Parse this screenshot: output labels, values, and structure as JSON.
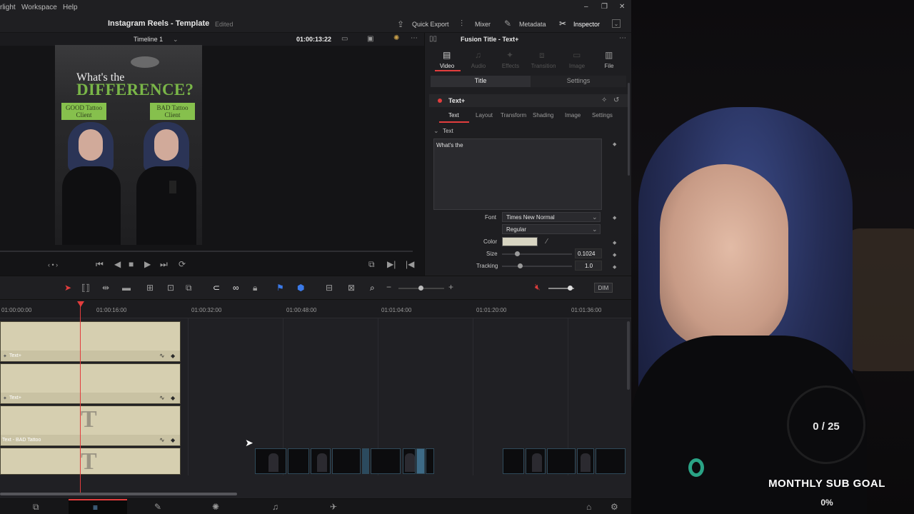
{
  "menu": {
    "app_fragment": "rlight",
    "workspace": "Workspace",
    "help": "Help"
  },
  "window": {
    "minimize": "–",
    "restore": "❐",
    "close": "✕"
  },
  "title": {
    "project": "Instagram Reels - Template",
    "status": "Edited"
  },
  "topnav": {
    "quick_export": "Quick Export",
    "mixer": "Mixer",
    "metadata": "Metadata",
    "inspector": "Inspector"
  },
  "viewer": {
    "timeline_name": "Timeline 1",
    "timecode": "01:00:13:22",
    "frame": {
      "headline_small": "What's the",
      "headline_big": "DIFFERENCE?",
      "left_label": "GOOD Tattoo Client",
      "right_label": "BAD Tattoo Client"
    }
  },
  "inspector": {
    "clip_name": "Fusion Title - Text+",
    "icon_tabs": [
      "Video",
      "Audio",
      "Effects",
      "Transition",
      "Image",
      "File"
    ],
    "active_icon_tab": "Video",
    "subtabs": {
      "title": "Title",
      "settings": "Settings"
    },
    "tool_name": "Text+",
    "tool_tabs": [
      "Text",
      "Layout",
      "Transform",
      "Shading",
      "Image",
      "Settings"
    ],
    "active_tool_tab": "Text",
    "section": "Text",
    "styled_text": "What's the",
    "font_label": "Font",
    "font_value": "Times New Normal",
    "style_value": "Regular",
    "color_label": "Color",
    "color_value": "#d8d5c2",
    "size_label": "Size",
    "size_value": "0.1024",
    "tracking_label": "Tracking",
    "tracking_value": "1.0"
  },
  "toolbar": {
    "dim_label": "DIM"
  },
  "timeline": {
    "ruler": [
      "01:00:00:00",
      "01:00:16:00",
      "01:00:32:00",
      "01:00:48:00",
      "01:01:04:00",
      "01:01:20:00",
      "01:01:36:00"
    ],
    "tracks": [
      {
        "clip_label": "Text+",
        "has_big_t": false
      },
      {
        "clip_label": "Text+",
        "has_big_t": false
      },
      {
        "clip_label": "Text - BAD Tattoo",
        "has_big_t": true,
        "big_t": "T"
      },
      {
        "clip_label": "",
        "has_big_t": true,
        "big_t": "T"
      }
    ]
  },
  "overlay": {
    "sub_count": "0 / 25",
    "goal_title": "MONTHLY SUB GOAL",
    "goal_percent": "0%"
  },
  "colors": {
    "accent_red": "#e23d3d",
    "text_clip": "#d6cfb0",
    "title_green": "#7ab648",
    "label_green": "#86c04d"
  }
}
